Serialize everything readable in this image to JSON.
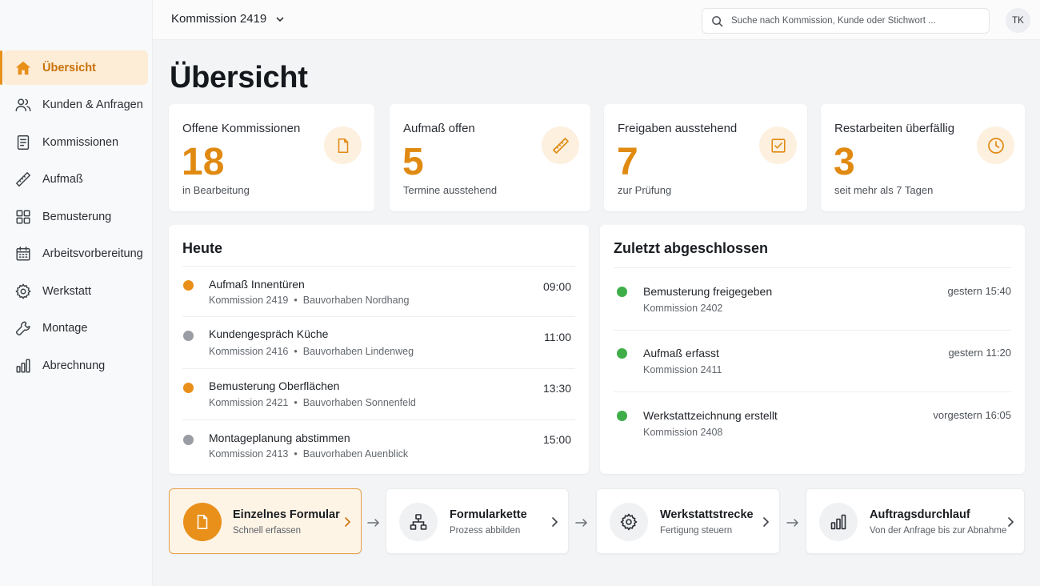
{
  "sidebar": {
    "items": [
      {
        "label": "Übersicht",
        "icon": "home-icon",
        "active": true
      },
      {
        "label": "Kunden & Anfragen",
        "icon": "users-icon"
      },
      {
        "label": "Kommissionen",
        "icon": "document-icon"
      },
      {
        "label": "Aufmaß",
        "icon": "ruler-icon"
      },
      {
        "label": "Bemusterung",
        "icon": "grid-icon"
      },
      {
        "label": "Arbeitsvorbereitung",
        "icon": "calendar-icon"
      },
      {
        "label": "Werkstatt",
        "icon": "gear-icon"
      },
      {
        "label": "Montage",
        "icon": "wrench-icon"
      },
      {
        "label": "Abrechnung",
        "icon": "bar-chart-icon"
      }
    ]
  },
  "header": {
    "project": "Kommission 2419",
    "search_placeholder": "Suche nach Kommission, Kunde oder Stichwort ...",
    "avatar": "TK"
  },
  "page": {
    "title": "Übersicht"
  },
  "stats": [
    {
      "title": "Offene Kommissionen",
      "value": "18",
      "sub": "in Bearbeitung",
      "icon": "document-icon"
    },
    {
      "title": "Aufmaß offen",
      "value": "5",
      "sub": "Termine ausstehend",
      "icon": "ruler-icon"
    },
    {
      "title": "Freigaben ausstehend",
      "value": "7",
      "sub": "zur Prüfung",
      "icon": "checkbox-icon"
    },
    {
      "title": "Restarbeiten überfällig",
      "value": "3",
      "sub": "seit mehr als 7 Tagen",
      "icon": "clock-icon"
    }
  ],
  "today": {
    "title": "Heute",
    "items": [
      {
        "title": "Aufmaß Innentüren",
        "kommission": "Kommission 2419",
        "project": "Bauvorhaben Nordhang",
        "time": "09:00",
        "color": "#e8901a"
      },
      {
        "title": "Kundengespräch Küche",
        "kommission": "Kommission 2416",
        "project": "Bauvorhaben Lindenweg",
        "time": "11:00",
        "color": "#9a9ea4"
      },
      {
        "title": "Bemusterung Oberflächen",
        "kommission": "Kommission 2421",
        "project": "Bauvorhaben Sonnenfeld",
        "time": "13:30",
        "color": "#e8901a"
      },
      {
        "title": "Montageplanung abstimmen",
        "kommission": "Kommission 2413",
        "project": "Bauvorhaben Auenblick",
        "time": "15:00",
        "color": "#9a9ea4"
      }
    ]
  },
  "recent": {
    "title": "Zuletzt abgeschlossen",
    "items": [
      {
        "title": "Bemusterung freigegeben",
        "kommission": "Kommission 2402",
        "time": "gestern 15:40",
        "color": "#3fae49"
      },
      {
        "title": "Aufmaß erfasst",
        "kommission": "Kommission 2411",
        "time": "gestern 11:20",
        "color": "#3fae49"
      },
      {
        "title": "Werkstattzeichnung erstellt",
        "kommission": "Kommission 2408",
        "time": "vorgestern 16:05",
        "color": "#3fae49"
      }
    ]
  },
  "workflow": [
    {
      "title": "Einzelnes Formular",
      "sub": "Schnell erfassen",
      "icon": "document-icon",
      "active": true
    },
    {
      "title": "Formularkette",
      "sub": "Prozess abbilden",
      "icon": "hierarchy-icon"
    },
    {
      "title": "Werkstattstrecke",
      "sub": "Fertigung steuern",
      "icon": "gear-icon"
    },
    {
      "title": "Auftragsdurchlauf",
      "sub": "Von der Anfrage bis zur Abnahme",
      "icon": "bar-chart-icon"
    }
  ],
  "colors": {
    "accent": "#e8901a",
    "accent_light": "#fdecd6",
    "success": "#3fae49",
    "neutral_dot": "#9a9ea4"
  }
}
